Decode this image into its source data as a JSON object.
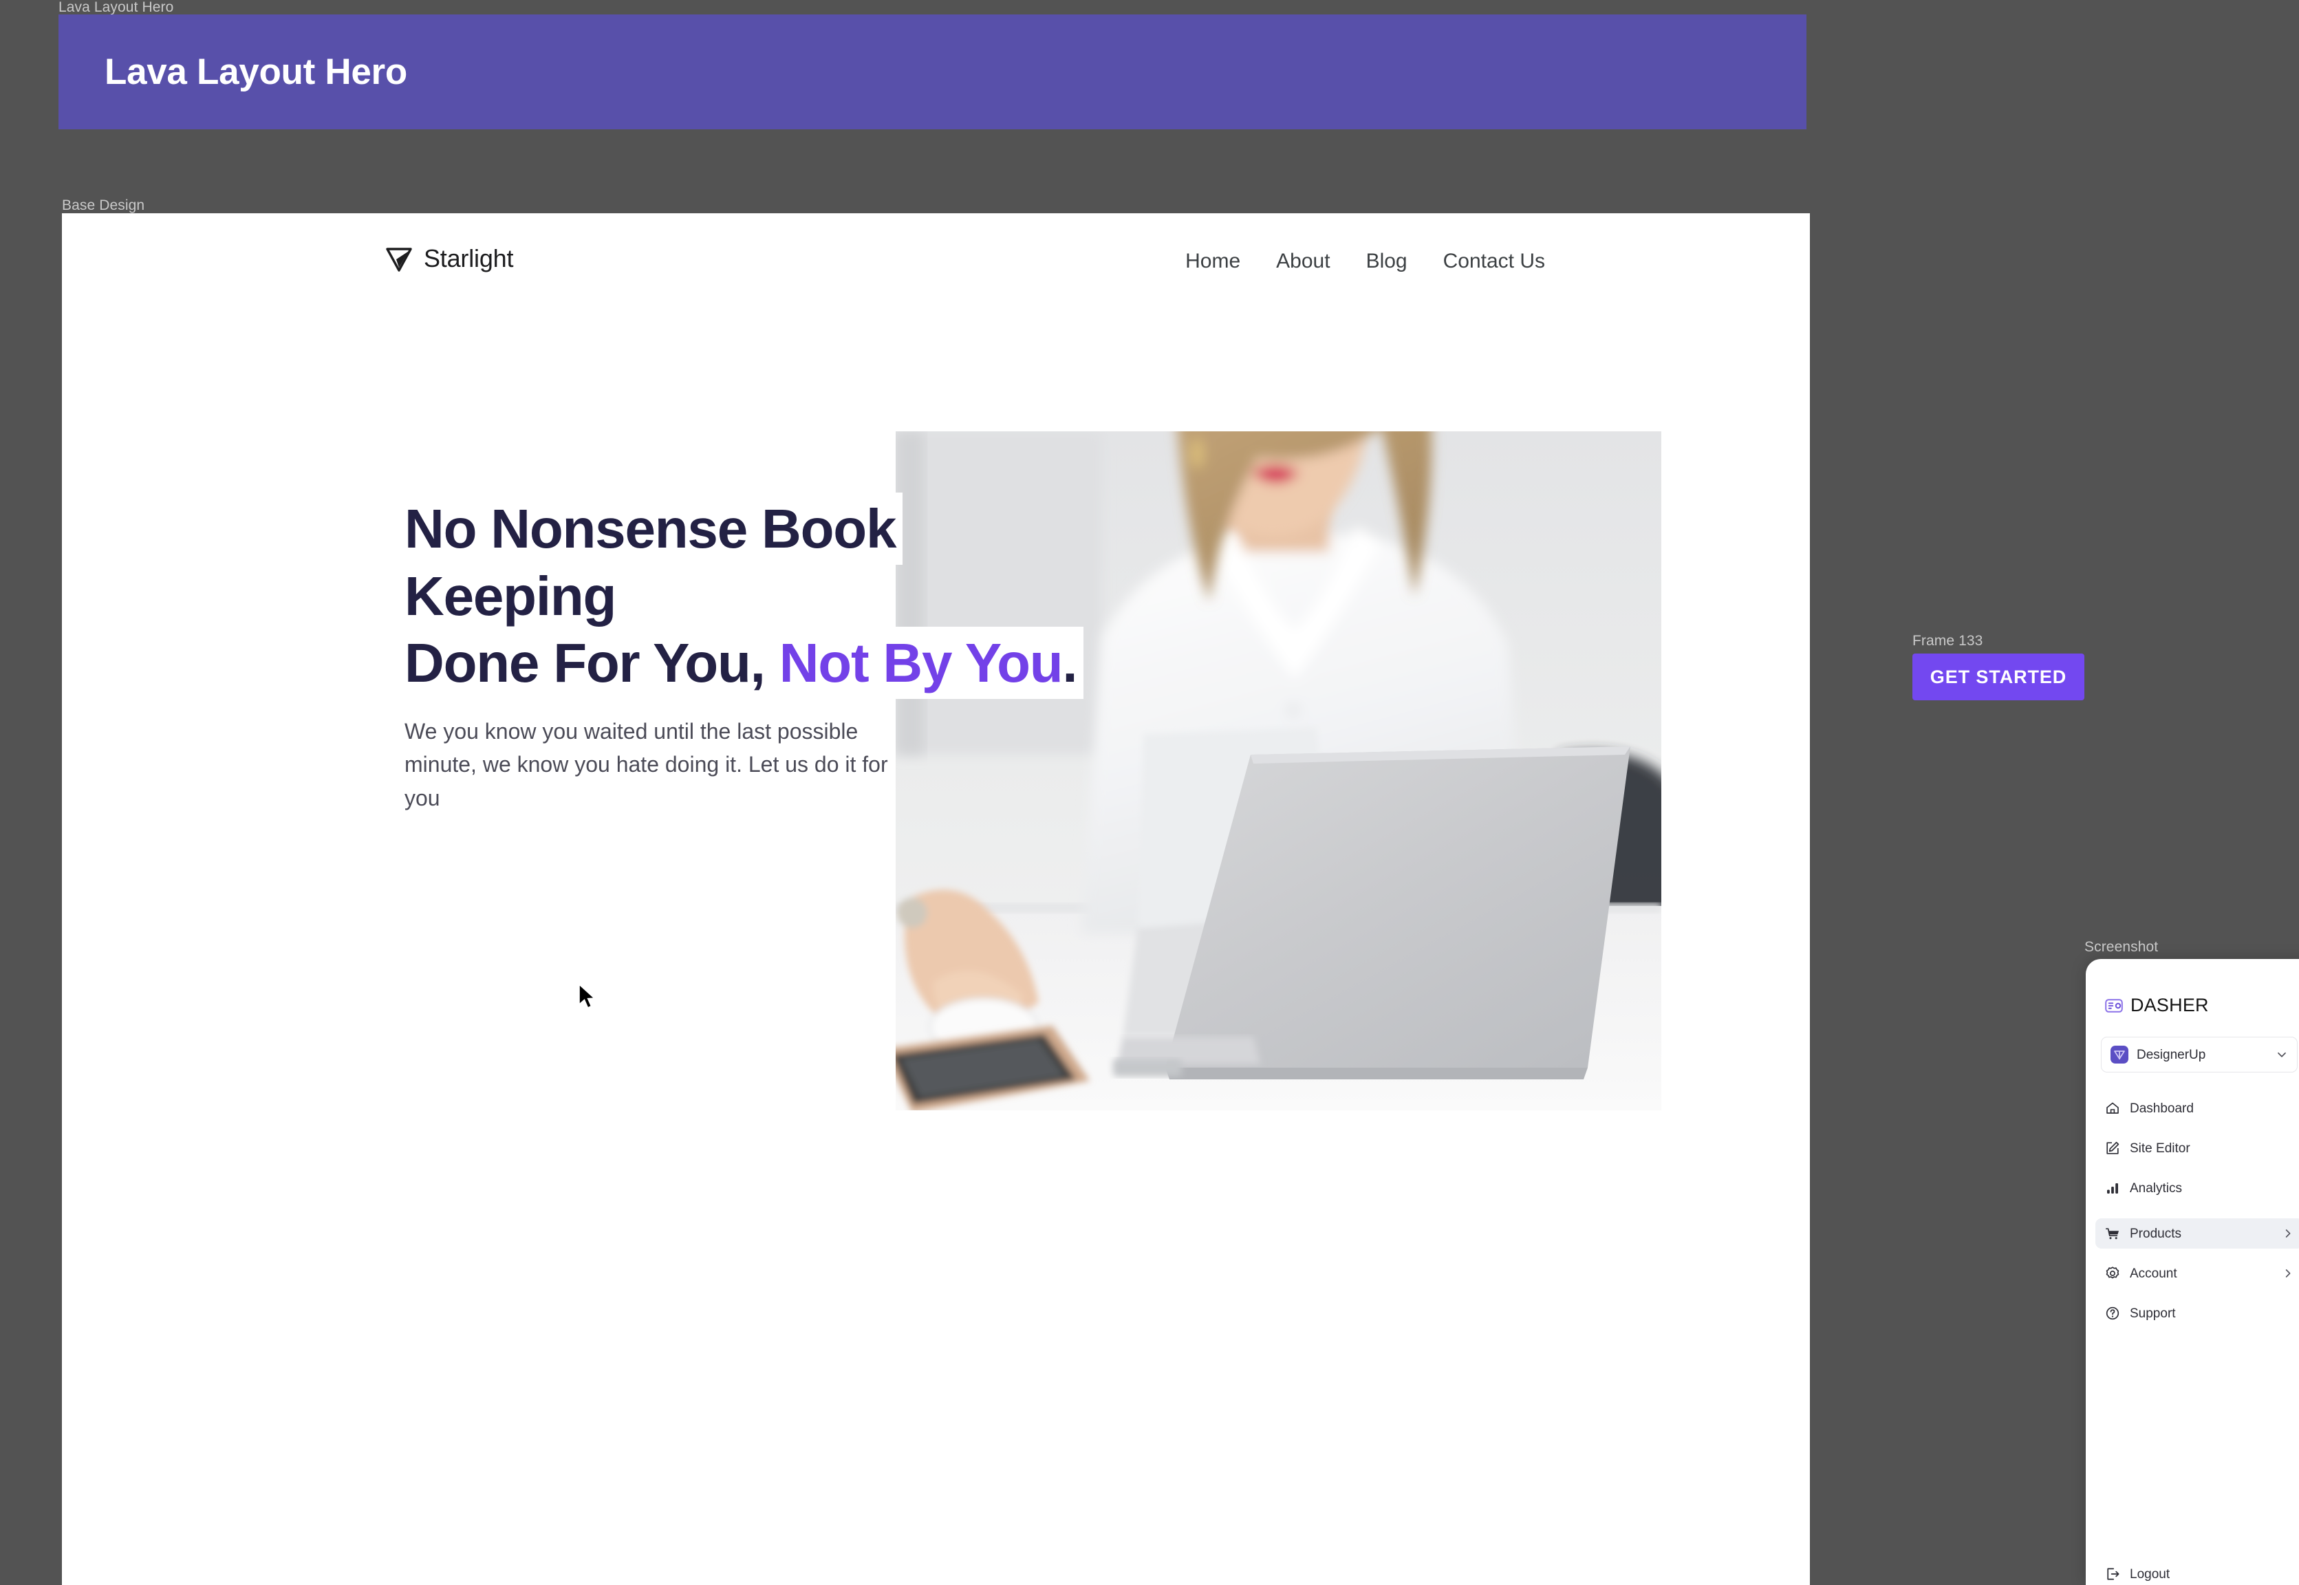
{
  "canvas": {
    "background_color": "#535353",
    "frames": {
      "hero_frame_label": "Lava Layout Hero",
      "base_design_label": "Base Design",
      "frame_133_label": "Frame 133",
      "screenshot_label": "Screenshot"
    }
  },
  "hero_banner": {
    "title": "Lava Layout Hero",
    "background_color": "#5850aa",
    "text_color": "#ffffff"
  },
  "site": {
    "brand": {
      "name": "Starlight",
      "logo_icon": "starlight-triangle-icon"
    },
    "nav_links": [
      {
        "label": "Home"
      },
      {
        "label": "About"
      },
      {
        "label": "Blog"
      },
      {
        "label": "Contact Us"
      }
    ],
    "hero": {
      "headline_line_1": "No Nonsense Book Keeping",
      "headline_line_2_plain": "Done For You,",
      "headline_line_2_accent": "Not By You",
      "headline_line_2_period": ".",
      "accent_color": "#7341e8",
      "headline_color": "#232144",
      "subheading_line_1": "We you know you waited until the last possible",
      "subheading_line_2": "minute, we know you hate doing it. Let us do it for you",
      "image_alt": "Woman in white blouse working at a laptop with a mouse and smartphone on a white desk"
    }
  },
  "frame_133": {
    "button_label": "GET STARTED",
    "button_color": "#7348f0",
    "button_text_color": "#ffffff"
  },
  "dasher": {
    "wordmark": "DASHER",
    "logo_icon": "dasher-card-icon",
    "workspace": {
      "name": "DesignerUp",
      "avatar_icon": "designerup-avatar-icon",
      "chevron_icon": "chevron-down-icon"
    },
    "nav_primary": [
      {
        "label": "Dashboard",
        "icon": "home-icon",
        "active": false,
        "has_chevron": false
      },
      {
        "label": "Site Editor",
        "icon": "edit-square-icon",
        "active": false,
        "has_chevron": false
      },
      {
        "label": "Analytics",
        "icon": "bar-chart-icon",
        "active": false,
        "has_chevron": false
      }
    ],
    "nav_secondary": [
      {
        "label": "Products",
        "icon": "shopping-cart-icon",
        "active": true,
        "has_chevron": true
      },
      {
        "label": "Account",
        "icon": "gear-icon",
        "active": false,
        "has_chevron": true
      },
      {
        "label": "Support",
        "icon": "question-circle-icon",
        "active": false,
        "has_chevron": false
      }
    ],
    "footer": [
      {
        "label": "Logout",
        "icon": "logout-icon",
        "active": false,
        "has_chevron": false
      }
    ]
  }
}
